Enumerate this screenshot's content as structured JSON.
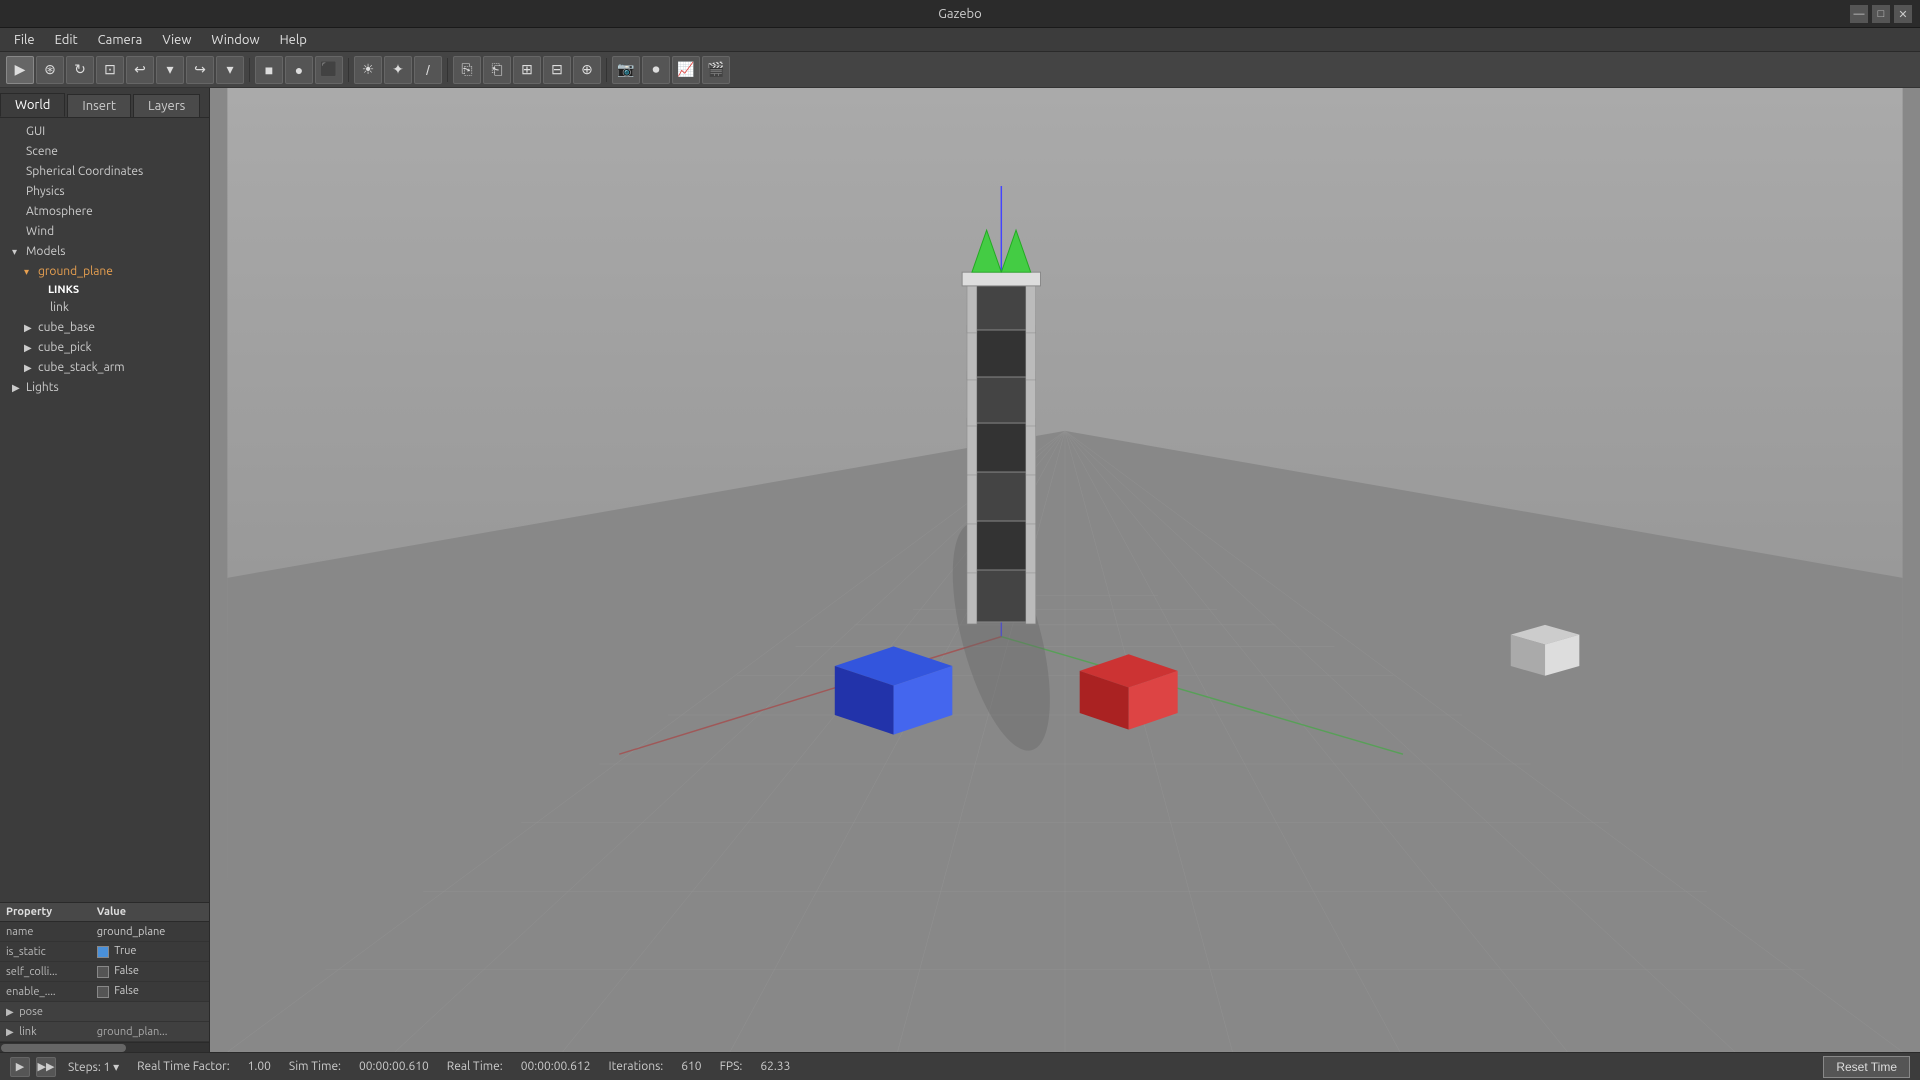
{
  "titlebar": {
    "title": "Gazebo",
    "minimize": "—",
    "maximize": "□",
    "close": "✕"
  },
  "menubar": {
    "items": [
      "File",
      "Edit",
      "Camera",
      "View",
      "Window",
      "Help"
    ]
  },
  "tabs": {
    "world": "World",
    "insert": "Insert",
    "layers": "Layers"
  },
  "tree": {
    "gui": "GUI",
    "scene": "Scene",
    "spherical_coords": "Spherical Coordinates",
    "physics": "Physics",
    "atmosphere": "Atmosphere",
    "wind": "Wind",
    "models": "Models",
    "ground_plane": "ground_plane",
    "links_label": "LINKS",
    "link": "link",
    "cube_base": "cube_base",
    "cube_pick": "cube_pick",
    "cube_stack_arm": "cube_stack_arm",
    "lights": "Lights"
  },
  "properties": {
    "header_property": "Property",
    "header_value": "Value",
    "rows": [
      {
        "property": "name",
        "value": "ground_plane"
      },
      {
        "property": "is_static",
        "value": "True",
        "checkbox": true,
        "checked": true
      },
      {
        "property": "self_colli...",
        "value": "False",
        "checkbox": true,
        "checked": false
      },
      {
        "property": "enable_....",
        "value": "False",
        "checkbox": true,
        "checked": false
      }
    ],
    "pose_label": "pose",
    "link_label": "link",
    "link_value": "ground_plan..."
  },
  "statusbar": {
    "steps_label": "Steps:",
    "steps_value": "1",
    "realtime_factor_label": "Real Time Factor:",
    "realtime_factor_value": "1.00",
    "sim_time_label": "Sim Time:",
    "sim_time_value": "00:00:00.610",
    "real_time_label": "Real Time:",
    "real_time_value": "00:00:00.612",
    "iterations_label": "Iterations:",
    "iterations_value": "610",
    "fps_label": "FPS:",
    "fps_value": "62.33",
    "reset_time": "Reset Time"
  }
}
